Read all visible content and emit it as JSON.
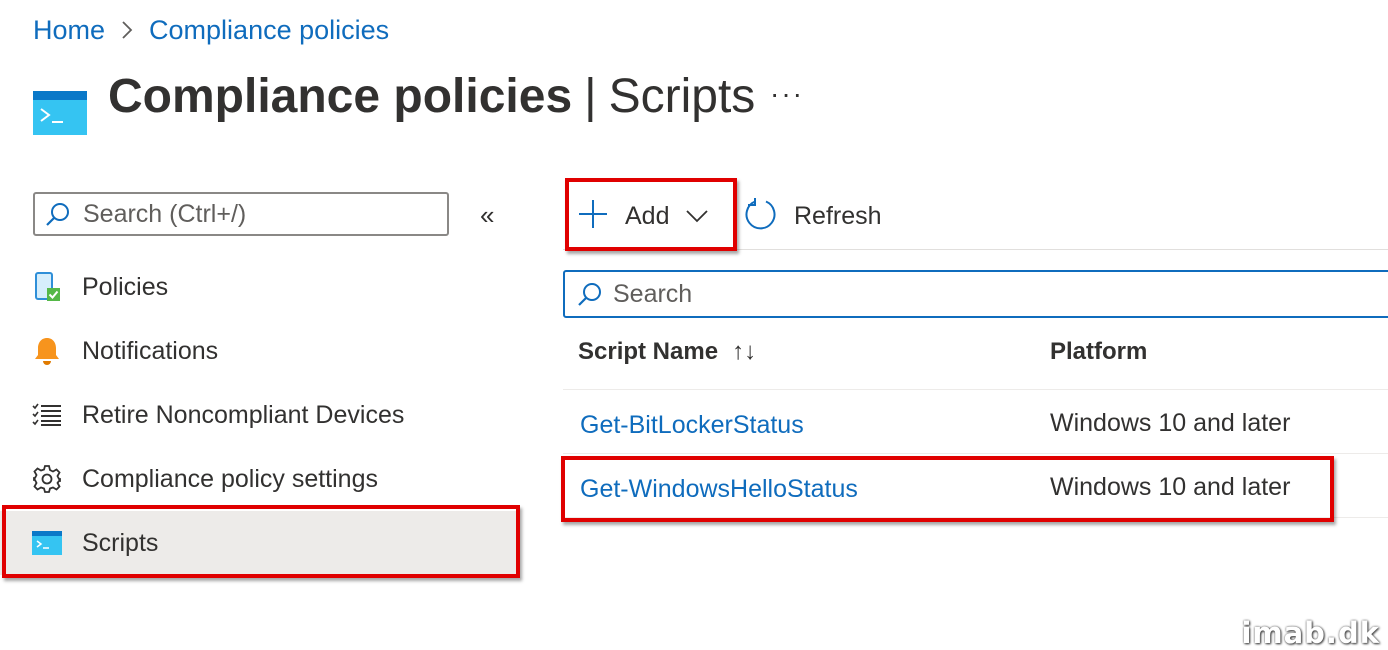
{
  "breadcrumb": {
    "home": "Home",
    "current": "Compliance policies"
  },
  "page": {
    "title": "Compliance policies",
    "separator": "|",
    "subtitle": "Scripts",
    "more_label": "···"
  },
  "nav": {
    "search_placeholder": "Search (Ctrl+/)",
    "collapse_label": "«",
    "items": [
      {
        "label": "Policies",
        "icon": "device-check-icon"
      },
      {
        "label": "Notifications",
        "icon": "bell-icon"
      },
      {
        "label": "Retire Noncompliant Devices",
        "icon": "checklist-icon"
      },
      {
        "label": "Compliance policy settings",
        "icon": "gear-icon"
      },
      {
        "label": "Scripts",
        "icon": "script-console-icon",
        "active": true
      }
    ]
  },
  "toolbar": {
    "add_label": "Add",
    "refresh_label": "Refresh"
  },
  "search": {
    "placeholder": "Search"
  },
  "table": {
    "columns": [
      "Script Name",
      "Platform"
    ],
    "sort_indicator": "↑↓",
    "rows": [
      {
        "name": "Get-BitLockerStatus",
        "platform": "Windows 10 and later"
      },
      {
        "name": "Get-WindowsHelloStatus",
        "platform": "Windows 10 and later"
      }
    ]
  },
  "colors": {
    "link": "#0f6cbd",
    "highlight": "#e00000",
    "active_bg": "#edebe9"
  },
  "watermark": "imab.dk"
}
